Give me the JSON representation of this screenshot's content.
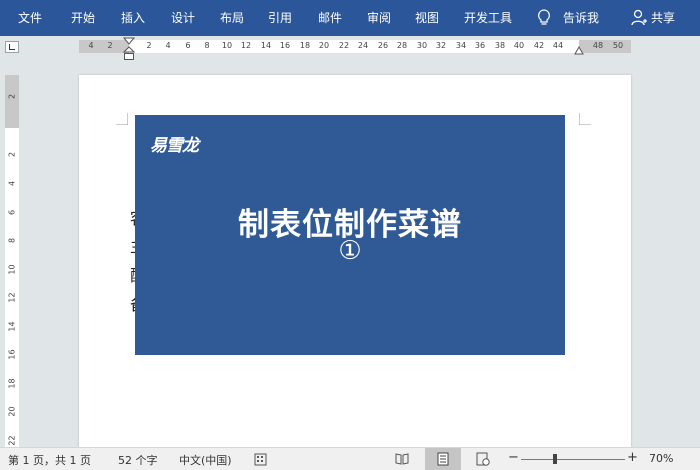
{
  "ribbon": {
    "tabs": [
      "文件",
      "开始",
      "插入",
      "设计",
      "布局",
      "引用",
      "邮件",
      "审阅",
      "视图",
      "开发工具"
    ],
    "tell_me": "告诉我",
    "share": "共享",
    "bg_color": "#2b579a"
  },
  "ruler": {
    "h_numbers": [
      "4",
      "2",
      "2",
      "4",
      "6",
      "8",
      "10",
      "12",
      "14",
      "16",
      "18",
      "20",
      "22",
      "24",
      "26",
      "28",
      "30",
      "32",
      "34",
      "36",
      "38",
      "40",
      "42",
      "44",
      "48",
      "50"
    ],
    "v_numbers": [
      "2",
      "2",
      "4",
      "6",
      "8",
      "10",
      "12",
      "14",
      "16",
      "18",
      "20",
      "22"
    ]
  },
  "page": {
    "text_fragments": [
      "客",
      "主",
      "配",
      "备"
    ]
  },
  "card": {
    "brand": "易雪龙",
    "title": "制表位制作菜谱",
    "number": "①",
    "bg_color": "#305a96"
  },
  "status": {
    "page": "第 1 页，共 1 页",
    "words": "52 个字",
    "language": "中文(中国)",
    "zoom": "70%",
    "zoom_minus": "−",
    "zoom_plus": "+"
  }
}
